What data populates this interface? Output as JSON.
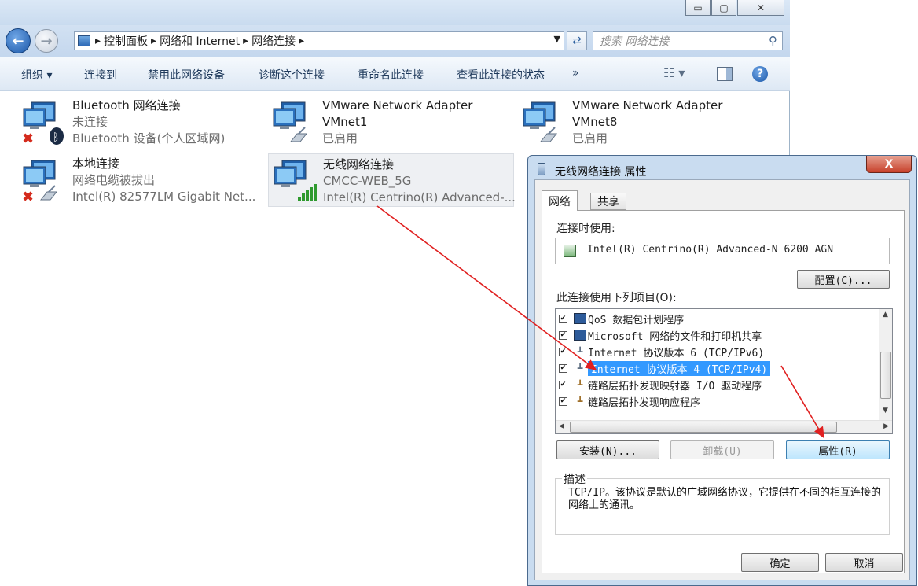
{
  "window": {
    "caption_buttons": {
      "minimize": "▭",
      "maximize": "▢",
      "close": "✕"
    }
  },
  "address_bar": {
    "breadcrumbs": [
      "控制面板",
      "网络和 Internet",
      "网络连接"
    ],
    "search_placeholder": "搜索 网络连接"
  },
  "command_bar": {
    "items": [
      "组织 ▾",
      "连接到",
      "禁用此网络设备",
      "诊断这个连接",
      "重命名此连接",
      "查看此连接的状态",
      "»"
    ]
  },
  "connections": [
    {
      "name": "Bluetooth 网络连接",
      "line2": "未连接",
      "line3": "Bluetooth 设备(个人区域网)",
      "status": "disconnected"
    },
    {
      "name": "VMware Network Adapter",
      "line2": "VMnet1",
      "line3": "已启用",
      "status": "enabled"
    },
    {
      "name": "VMware Network Adapter",
      "line2": "VMnet8",
      "line3": "已启用",
      "status": "enabled"
    },
    {
      "name": "本地连接",
      "line2": "网络电缆被拔出",
      "line3": "Intel(R) 82577LM Gigabit Net...",
      "status": "disconnected"
    },
    {
      "name": "无线网络连接",
      "line2": "CMCC-WEB_5G",
      "line3": "Intel(R) Centrino(R) Advanced-...",
      "status": "connected"
    }
  ],
  "dialog": {
    "title": "无线网络连接 属性",
    "tabs": [
      "网络",
      "共享"
    ],
    "connect_using_label": "连接时使用:",
    "adapter_name": "Intel(R) Centrino(R) Advanced-N 6200 AGN",
    "configure_button": "配置(C)...",
    "items_label": "此连接使用下列项目(O):",
    "items": [
      {
        "label": "QoS 数据包计划程序",
        "checked": true,
        "selected": false
      },
      {
        "label": "Microsoft 网络的文件和打印机共享",
        "checked": true,
        "selected": false
      },
      {
        "label": "Internet 协议版本 6 (TCP/IPv6)",
        "checked": true,
        "selected": false
      },
      {
        "label": "Internet 协议版本 4 (TCP/IPv4)",
        "checked": true,
        "selected": true
      },
      {
        "label": "链路层拓扑发现映射器 I/O 驱动程序",
        "checked": true,
        "selected": false
      },
      {
        "label": "链路层拓扑发现响应程序",
        "checked": true,
        "selected": false
      }
    ],
    "install_button": "安装(N)...",
    "uninstall_button": "卸载(U)",
    "properties_button": "属性(R)",
    "description_legend": "描述",
    "description_text": "TCP/IP。该协议是默认的广域网络协议，它提供在不同的相互连接的网络上的通讯。",
    "ok_button": "确定",
    "cancel_button": "取消",
    "close_button": "X"
  },
  "colors": {
    "annotation_arrow": "#e02020",
    "selection": "#3399ff",
    "disconnected": "#d42a1c"
  }
}
